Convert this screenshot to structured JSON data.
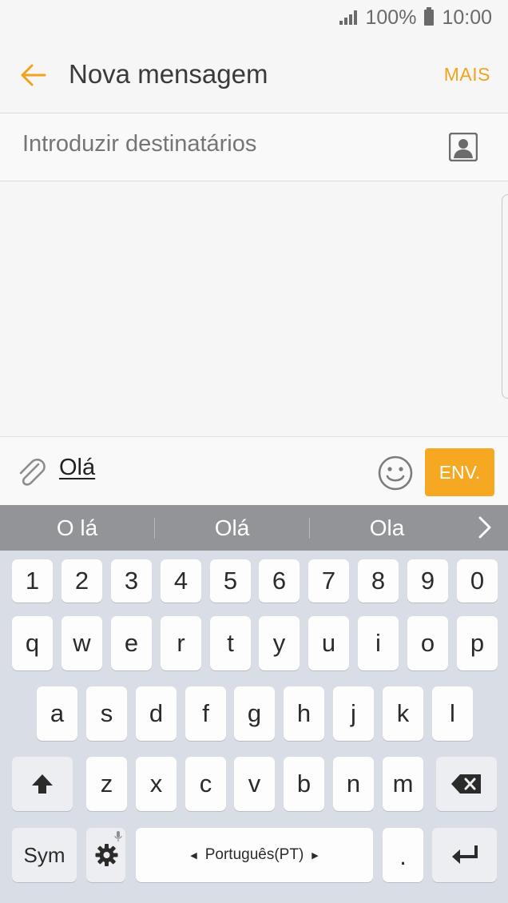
{
  "status_bar": {
    "battery_text": "100%",
    "time": "10:00"
  },
  "app_bar": {
    "title": "Nova mensagem",
    "more_label": "MAIS"
  },
  "recipients": {
    "placeholder": "Introduzir destinatários"
  },
  "compose": {
    "text": "Olá",
    "send_label": "ENV."
  },
  "suggestions": [
    "O lá",
    "Olá",
    "Ola"
  ],
  "keyboard": {
    "number_row": [
      "1",
      "2",
      "3",
      "4",
      "5",
      "6",
      "7",
      "8",
      "9",
      "0"
    ],
    "row1": [
      "q",
      "w",
      "e",
      "r",
      "t",
      "y",
      "u",
      "i",
      "o",
      "p"
    ],
    "row2": [
      "a",
      "s",
      "d",
      "f",
      "g",
      "h",
      "j",
      "k",
      "l"
    ],
    "row3": [
      "z",
      "x",
      "c",
      "v",
      "b",
      "n",
      "m"
    ],
    "sym_label": "Sym",
    "space_label": "Português(PT)",
    "period_label": "."
  },
  "colors": {
    "accent": "#f7a823",
    "accent_text": "#f2a31d"
  }
}
